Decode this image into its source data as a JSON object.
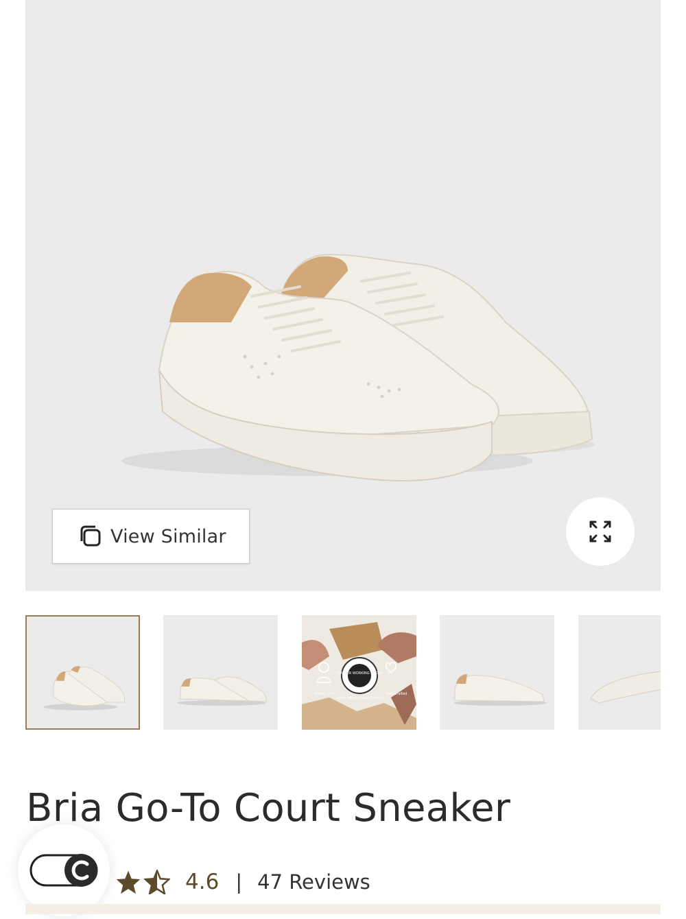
{
  "product": {
    "title": "Bria Go-To Court Sneaker",
    "rating": {
      "value": "4.6",
      "stars_filled_fraction": 0.5,
      "divider": "|",
      "reviews_label": "47 Reviews"
    }
  },
  "hero": {
    "view_similar_label": "View Similar",
    "view_similar_icon": "copy-stack-icon",
    "expand_icon": "expand-arrows-icon"
  },
  "thumbnails": [
    {
      "label": "pair-angle-view",
      "selected": true
    },
    {
      "label": "pair-side-view",
      "selected": false
    },
    {
      "label": "leather-working-group-video",
      "selected": false
    },
    {
      "label": "single-side-view",
      "selected": false
    },
    {
      "label": "sole-view",
      "selected": false
    }
  ],
  "video_thumb_text": {
    "badge": "LEATHER WORKING GROUP",
    "caption_left": "Women Led",
    "caption_center": "Leather Working Group Certified",
    "caption_right": "Handcrafted"
  },
  "colors": {
    "accent_brown": "#9a7a4e",
    "star_color": "#5b4a2c",
    "hero_background": "#ebebeb",
    "sneaker_white": "#f3f0e8",
    "heel_tan": "#d2a878"
  },
  "consent_icon": "cookie-toggle-icon"
}
